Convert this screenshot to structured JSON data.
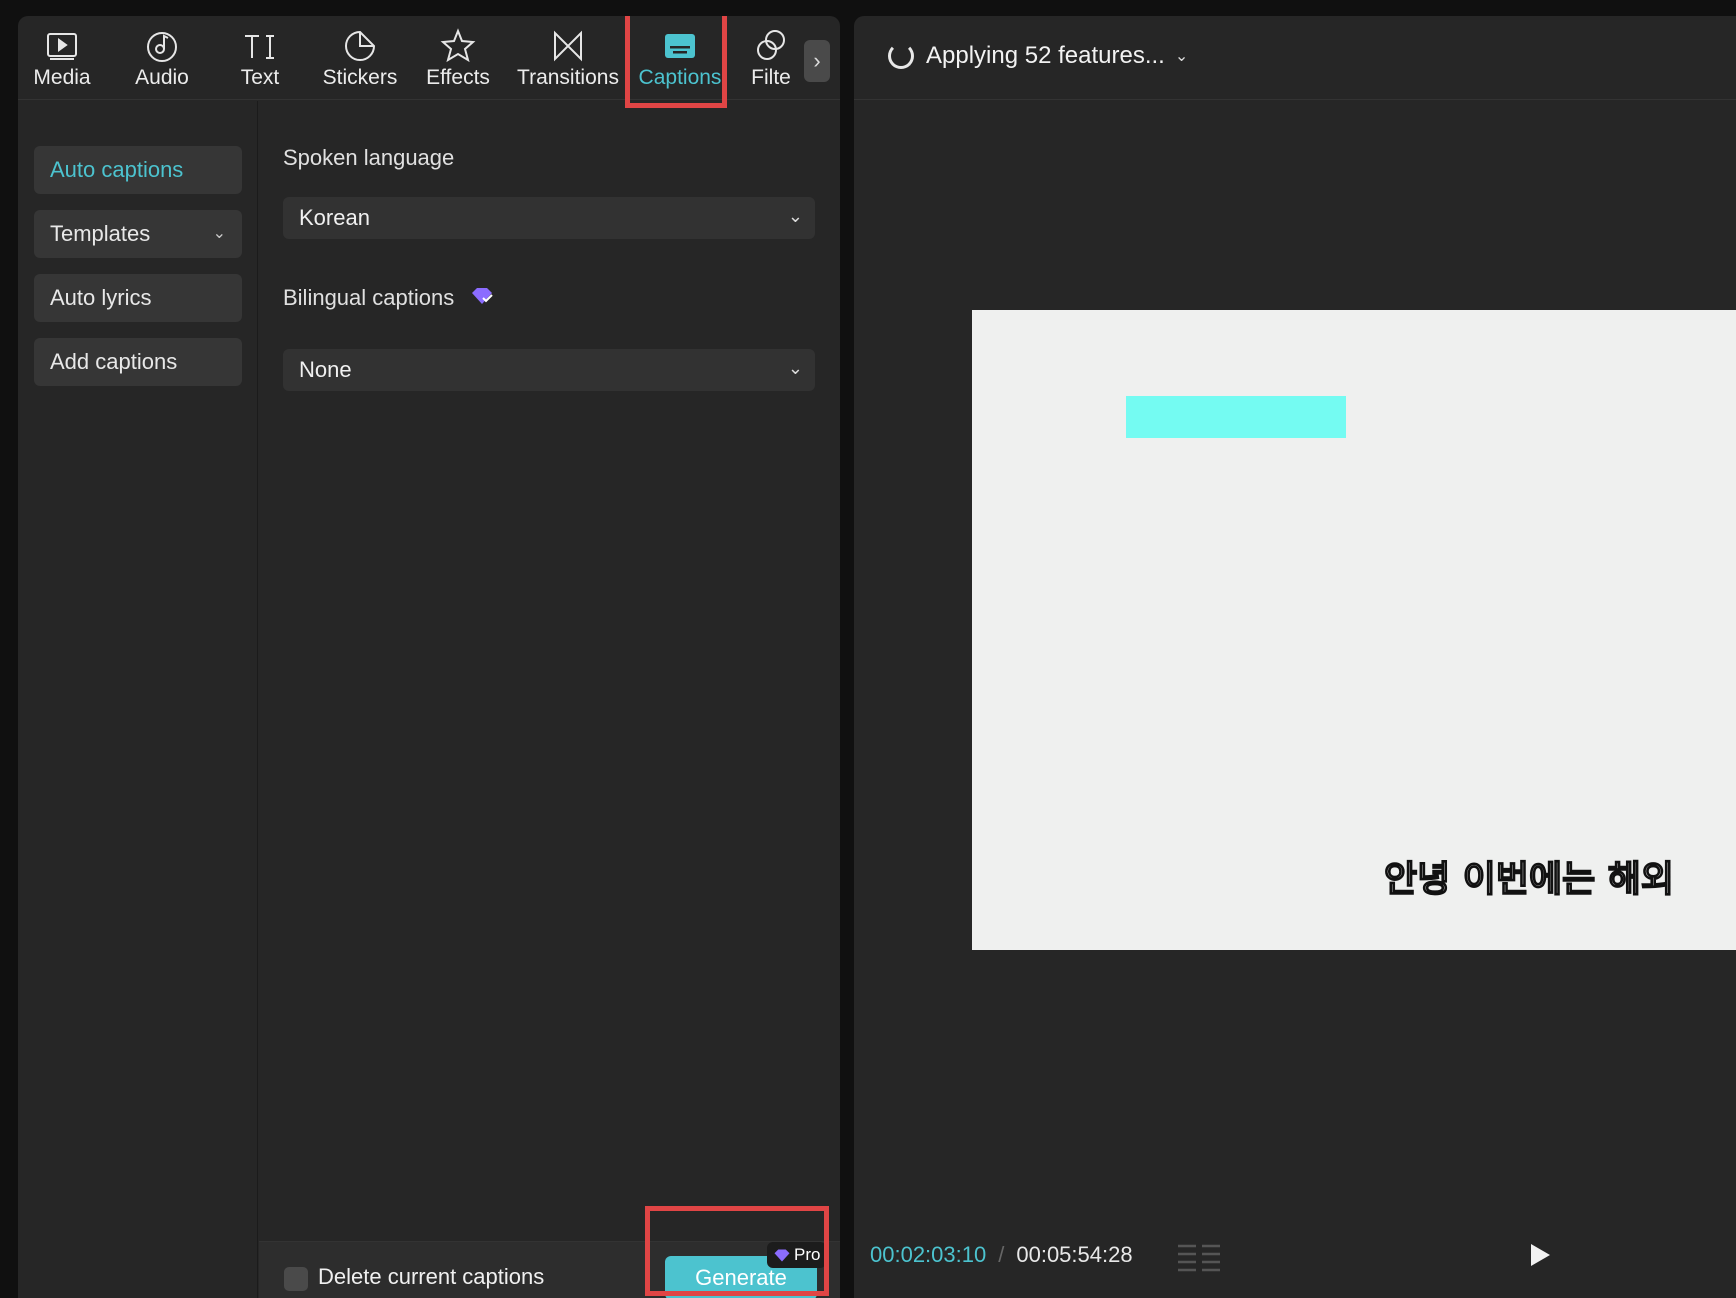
{
  "toolbar": {
    "tabs": [
      {
        "label": "Media"
      },
      {
        "label": "Audio"
      },
      {
        "label": "Text"
      },
      {
        "label": "Stickers"
      },
      {
        "label": "Effects"
      },
      {
        "label": "Transitions"
      },
      {
        "label": "Captions"
      },
      {
        "label": "Filte"
      }
    ],
    "active_tab": "Captions",
    "more_glyph": "›"
  },
  "sidebar": {
    "items": [
      {
        "label": "Auto captions"
      },
      {
        "label": "Templates"
      },
      {
        "label": "Auto lyrics"
      },
      {
        "label": "Add captions"
      }
    ],
    "active_item": "Auto captions"
  },
  "captions_form": {
    "spoken_language_label": "Spoken language",
    "spoken_language_value": "Korean",
    "bilingual_label": "Bilingual captions",
    "bilingual_value": "None",
    "delete_label": "Delete current captions",
    "generate_label": "Generate",
    "pro_badge": "Pro"
  },
  "preview": {
    "status": "Applying 52 features...",
    "caption_text": "안녕 이번에는 해외",
    "time_current": "00:02:03:10",
    "time_separator": "/",
    "time_total": "00:05:54:28"
  },
  "colors": {
    "accent": "#4cc3cf",
    "highlight": "#e04545",
    "preview_rect": "#74fbf2",
    "pro_gem": "#8b6cff"
  }
}
